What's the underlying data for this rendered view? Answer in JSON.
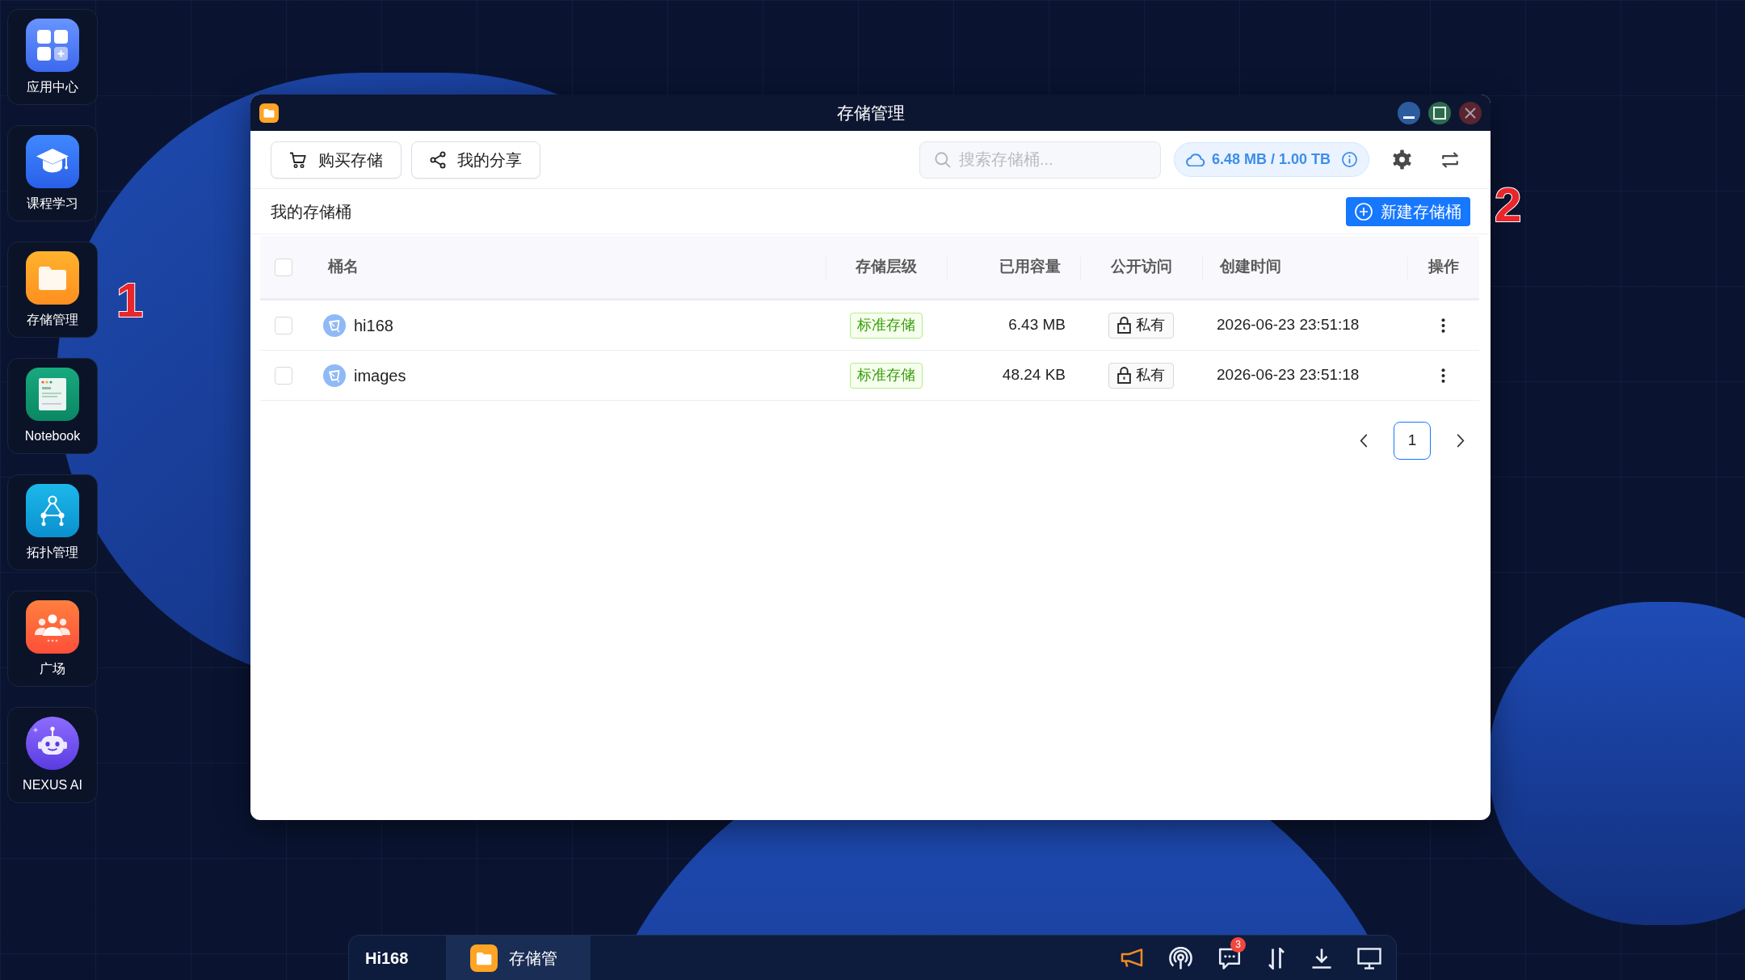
{
  "dock": [
    {
      "label": "应用中心"
    },
    {
      "label": "课程学习"
    },
    {
      "label": "存储管理"
    },
    {
      "label": "Notebook"
    },
    {
      "label": "拓扑管理"
    },
    {
      "label": "广场"
    },
    {
      "label": "NEXUS AI"
    }
  ],
  "callouts": [
    {
      "text": "1"
    },
    {
      "text": "2"
    }
  ],
  "window": {
    "title": "存储管理"
  },
  "toolbar": {
    "buttons": [
      {
        "label": "购买存储"
      },
      {
        "label": "我的分享"
      }
    ],
    "search": {
      "placeholder": "搜索存储桶..."
    },
    "usage": "6.48 MB / 1.00 TB"
  },
  "section": {
    "title": "我的存储桶",
    "new_button": "新建存储桶"
  },
  "table": {
    "select_all": {
      "checked": false
    },
    "columns": [
      "桶名",
      "存储层级",
      "已用容量",
      "公开访问",
      "创建时间",
      "操作"
    ],
    "rows": [
      {
        "checked": false,
        "name": "hi168",
        "tier": "标准存储",
        "used": "6.43 MB",
        "access": "私有",
        "created": "2026-06-23 23:51:18"
      },
      {
        "checked": false,
        "name": "images",
        "tier": "标准存储",
        "used": "48.24 KB",
        "access": "私有",
        "created": "2026-06-23 23:51:18"
      }
    ]
  },
  "pagination": {
    "pages": [
      {
        "label": "1",
        "selected": true
      }
    ]
  },
  "taskbar": {
    "user": "Hi168",
    "apps": [
      {
        "label": "存储管",
        "selected": true
      }
    ],
    "badge": "3"
  }
}
